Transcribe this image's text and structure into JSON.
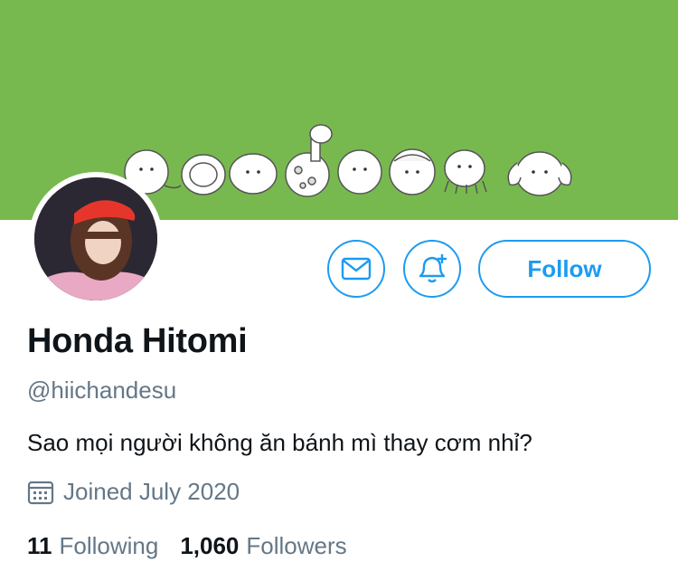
{
  "profile": {
    "display_name": "Honda Hitomi",
    "handle": "@hiichandesu",
    "bio": "Sao mọi người không ăn bánh mì thay cơm nhỉ?",
    "joined": "Joined July 2020"
  },
  "actions": {
    "message_icon": "envelope-icon",
    "notify_icon": "bell-plus-icon",
    "follow_label": "Follow"
  },
  "stats": {
    "following_count": "11",
    "following_label": "Following",
    "followers_count": "1,060",
    "followers_label": "Followers"
  },
  "colors": {
    "banner": "#78b94f",
    "accent": "#1d9bf0",
    "secondary_text": "#657786"
  }
}
